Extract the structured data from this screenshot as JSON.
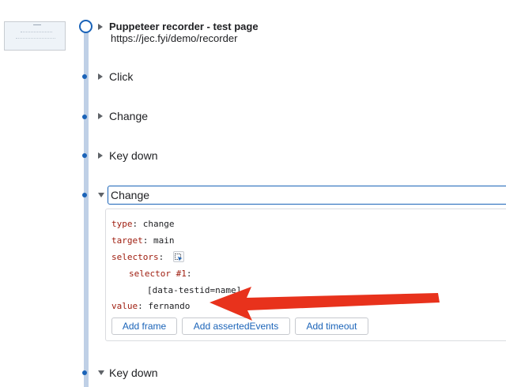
{
  "recording": {
    "title": "Puppeteer recorder - test page",
    "url": "https://jec.fyi/demo/recorder"
  },
  "steps": [
    {
      "label": "Click"
    },
    {
      "label": "Change"
    },
    {
      "label": "Key down"
    },
    {
      "label": "Change"
    },
    {
      "label": "Key down"
    }
  ],
  "details": {
    "type_key": "type",
    "type_value": "change",
    "target_key": "target",
    "target_value": "main",
    "selectors_key": "selectors",
    "selector1_key": "selector #1",
    "selector1_value": "[data-testid=name]",
    "value_key": "value",
    "value_value": "fernando"
  },
  "buttons": {
    "add_frame": "Add frame",
    "add_asserted": "Add assertedEvents",
    "add_timeout": "Add timeout"
  },
  "colors": {
    "accent": "#1a63b8",
    "annotation_arrow": "#e8321c",
    "key_text": "#9e1b0d"
  },
  "icons": {
    "select_element": "cursor-select-icon",
    "expand": "triangle-right-icon",
    "collapse": "triangle-down-icon"
  }
}
